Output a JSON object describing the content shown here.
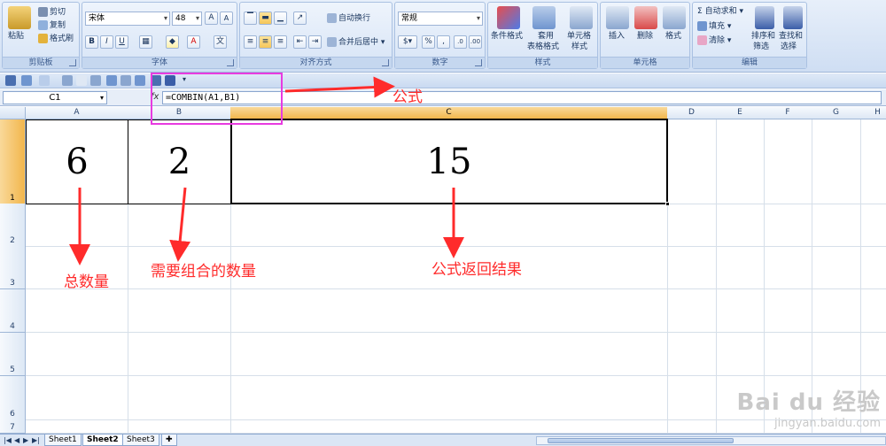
{
  "ribbon": {
    "clipboard": {
      "label": "剪贴板",
      "paste": "粘贴",
      "cut": "剪切",
      "copy": "复制",
      "format_painter": "格式刷"
    },
    "font": {
      "label": "字体",
      "name": "宋体",
      "size": "48"
    },
    "alignment": {
      "label": "对齐方式",
      "wrap_text": "自动换行",
      "merge_center": "合并后居中"
    },
    "number": {
      "label": "数字",
      "format": "常规"
    },
    "styles": {
      "label": "样式",
      "conditional_line1": "条件格式",
      "table_line1": "套用",
      "table_line2": "表格格式",
      "cell_styles_line1": "单元格",
      "cell_styles_line2": "样式"
    },
    "cells": {
      "label": "单元格",
      "insert": "插入",
      "delete": "删除",
      "format": "格式"
    },
    "editing": {
      "label": "编辑",
      "autosum": "自动求和",
      "fill": "填充",
      "clear": "清除",
      "sort_line1": "排序和",
      "sort_line2": "筛选",
      "find_line1": "查找和",
      "find_line2": "选择"
    }
  },
  "formula_bar": {
    "name_box": "C1",
    "fx": "fx",
    "formula": "=COMBIN(A1,B1)"
  },
  "columns": [
    "A",
    "B",
    "C",
    "D",
    "E",
    "F",
    "G",
    "H"
  ],
  "rows": [
    "1",
    "2",
    "3",
    "4",
    "5",
    "6",
    "7"
  ],
  "cells": {
    "A1": "6",
    "B1": "2",
    "C1": "15"
  },
  "annotations": {
    "formula": "公式",
    "total": "总数量",
    "combine": "需要组合的数量",
    "result": "公式返回结果"
  },
  "sheets": [
    "Sheet1",
    "Sheet2",
    "Sheet3"
  ],
  "watermark": {
    "line1": "Bai du 经验",
    "line2": "jingyan.baidu.com"
  },
  "colors": {
    "annotation_red": "#ff2b2b",
    "highlight_magenta": "#e83be0",
    "selected_header": "#f2b64c"
  }
}
